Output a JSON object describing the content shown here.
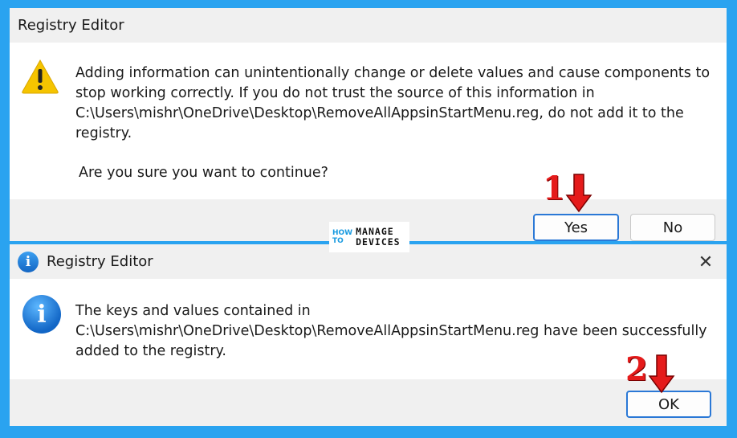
{
  "dialog1": {
    "title": "Registry Editor",
    "message": "Adding information can unintentionally change or delete values and cause components to stop working correctly. If you do not trust the source of this information in C:\\Users\\mishr\\OneDrive\\Desktop\\RemoveAllAppsinStartMenu.reg, do not add it to the registry.",
    "question": "Are you sure you want to continue?",
    "icon": "warning-icon",
    "buttons": {
      "yes": "Yes",
      "no": "No"
    }
  },
  "dialog2": {
    "title": "Registry Editor",
    "message": "The keys and values contained in C:\\Users\\mishr\\OneDrive\\Desktop\\RemoveAllAppsinStartMenu.reg have been successfully added to the registry.",
    "icon": "info-icon",
    "close_symbol": "✕",
    "buttons": {
      "ok": "OK"
    }
  },
  "steps": {
    "step1": "1",
    "step2": "2"
  },
  "logo": {
    "how": "HOW",
    "to": "TO",
    "manage": "MANAGE",
    "devices": "DEVICES"
  },
  "colors": {
    "background": "#2aa3f0",
    "annotation_red": "#e51b1b",
    "primary_button_border": "#2a78d6",
    "warning_yellow": "#f5c400"
  }
}
